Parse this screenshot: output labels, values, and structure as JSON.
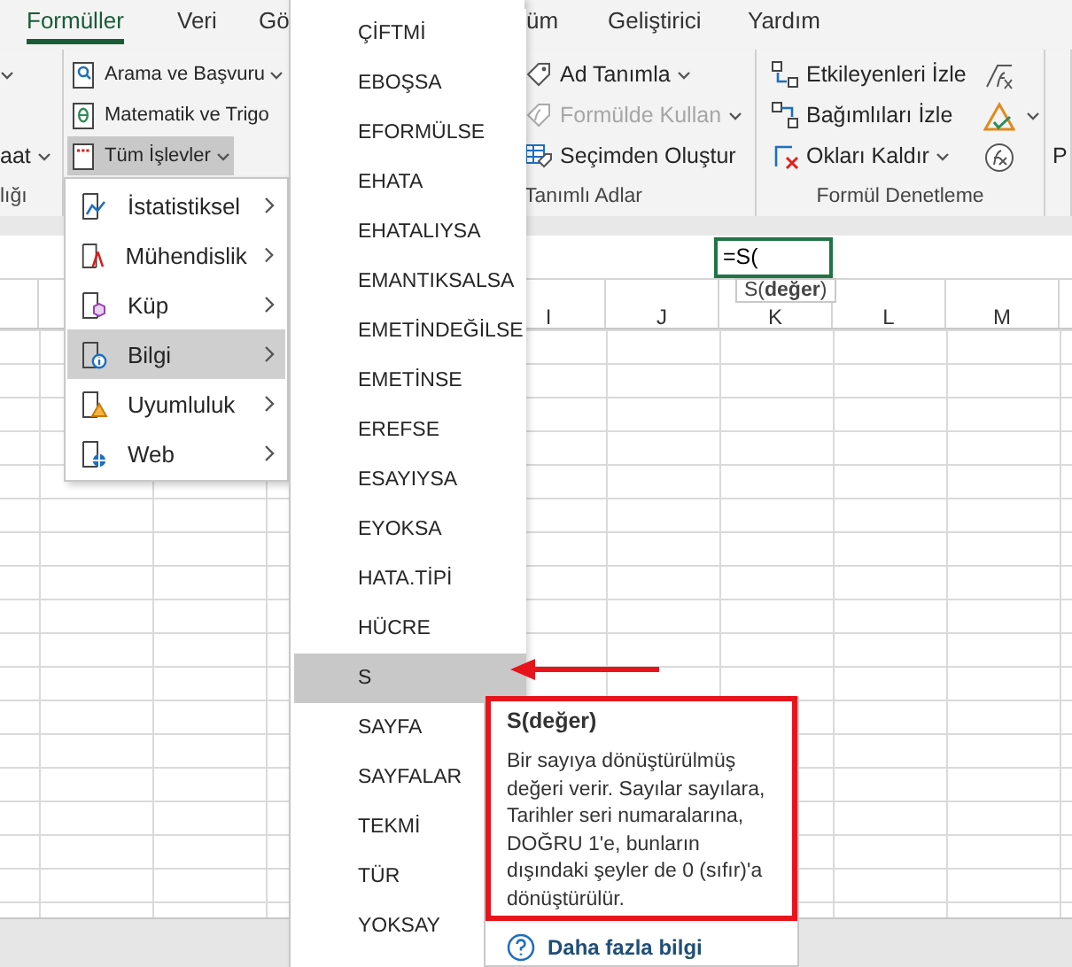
{
  "ribbon_tabs": [
    {
      "label": "Formüller",
      "selected": true
    },
    {
      "label": "Veri",
      "selected": false
    },
    {
      "label": "Gö",
      "selected": false
    },
    {
      "label": "üm",
      "selected": false
    },
    {
      "label": "Geliştirici",
      "selected": false
    },
    {
      "label": "Yardım",
      "selected": false
    }
  ],
  "ribbon_groups": [
    {
      "kind": "plain",
      "label": "lığı",
      "commands": [
        {
          "kind": "arrow",
          "dropdown": true,
          "disabled": false,
          "pressed": false
        },
        {
          "kind": "blank"
        },
        {
          "kind": "button",
          "label": "aat",
          "dropdown": true,
          "disabled": false,
          "pressed": false
        }
      ]
    },
    {
      "kind": "plain",
      "commands": [
        {
          "kind": "button",
          "label": "Arama ve Başvuru",
          "dropdown": true,
          "disabled": false,
          "pressed": false
        },
        {
          "kind": "button",
          "label": "Matematik ve Trigo",
          "dropdown": false,
          "disabled": false,
          "pressed": false
        },
        {
          "kind": "button",
          "label": "Tüm İşlevler",
          "dropdown": true,
          "disabled": false,
          "pressed": true
        }
      ]
    },
    {
      "kind": "plain",
      "label": "Tanımlı Adlar",
      "commands": [
        {
          "kind": "button",
          "label": "Ad Tanımla",
          "dropdown": true,
          "disabled": false,
          "pressed": false
        },
        {
          "kind": "button",
          "label": "Formülde Kullan",
          "dropdown": true,
          "disabled": true,
          "pressed": false
        },
        {
          "kind": "button",
          "label": "Seçimden Oluştur",
          "dropdown": false,
          "disabled": false,
          "pressed": false
        }
      ]
    },
    {
      "kind": "auditing",
      "label": "Formül Denetleme",
      "commands": [
        {
          "kind": "button",
          "label": "Etkileyenleri İzle",
          "dropdown": false,
          "disabled": false,
          "pressed": false
        },
        {
          "kind": "button",
          "label": "Bağımlıları İzle",
          "dropdown": false,
          "disabled": false,
          "pressed": false
        },
        {
          "kind": "button",
          "label": "Okları Kaldır",
          "dropdown": true,
          "disabled": false,
          "pressed": false
        }
      ]
    },
    {
      "kind": "plain",
      "commands": [
        {
          "kind": "blank"
        },
        {
          "kind": "blank"
        },
        {
          "kind": "button",
          "label": "P",
          "disabled": false,
          "pressed": false
        }
      ]
    }
  ],
  "formula_bar": {
    "value": "=S(",
    "hint": "S(**değer**)"
  },
  "columns": [
    "I",
    "J",
    "K",
    "L",
    "M"
  ],
  "category_menu": [
    {
      "label": "İstatistiksel",
      "selected": false
    },
    {
      "label": "Mühendislik",
      "selected": false
    },
    {
      "label": "Küp",
      "selected": false
    },
    {
      "label": "Bilgi",
      "selected": true
    },
    {
      "label": "Uyumluluk",
      "selected": false
    },
    {
      "label": "Web",
      "selected": false
    }
  ],
  "function_list": [
    {
      "label": "ÇİFTMİ",
      "selected": false
    },
    {
      "label": "EBOŞSA",
      "selected": false
    },
    {
      "label": "EFORMÜLSE",
      "selected": false
    },
    {
      "label": "EHATA",
      "selected": false
    },
    {
      "label": "EHATALIYSA",
      "selected": false
    },
    {
      "label": "EMANTIKSALSA",
      "selected": false
    },
    {
      "label": "EMETİNDEĞİLSE",
      "selected": false
    },
    {
      "label": "EMETİNSE",
      "selected": false
    },
    {
      "label": "EREFSE",
      "selected": false
    },
    {
      "label": "ESAYIYSA",
      "selected": false
    },
    {
      "label": "EYOKSA",
      "selected": false
    },
    {
      "label": "HATA.TİPİ",
      "selected": false
    },
    {
      "label": "HÜCRE",
      "selected": false
    },
    {
      "label": "S",
      "selected": true
    },
    {
      "label": "SAYFA",
      "selected": false
    },
    {
      "label": "SAYFALAR",
      "selected": false
    },
    {
      "label": "TEKMİ",
      "selected": false
    },
    {
      "label": "TÜR",
      "selected": false
    },
    {
      "label": "YOKSAY",
      "selected": false
    }
  ],
  "function_tooltip": {
    "title": "S(değer)",
    "description": "Bir sayıya dönüştürülmüş değeri verir. Sayılar sayılara, Tarihler seri numaralarına, DOĞRU 1'e, bunların dışındaki şeyler de 0 (sıfır)'a dönüştürülür.",
    "link": "Daha fazla bilgi"
  }
}
